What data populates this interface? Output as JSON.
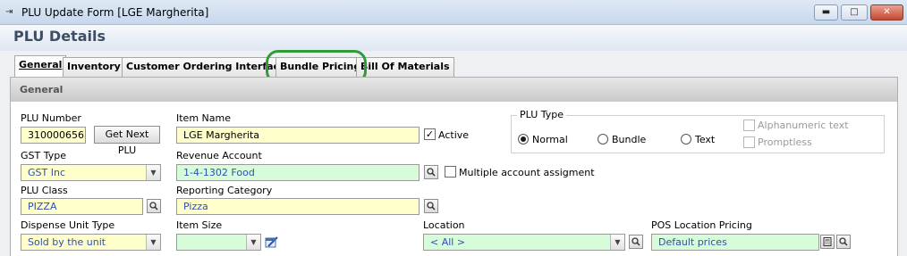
{
  "window": {
    "title": "PLU Update Form [LGE Margherita]",
    "min_label": "▬",
    "max_label": "□",
    "close_label": "✕"
  },
  "header": {
    "title": "PLU Details"
  },
  "tabs": [
    {
      "label": "General",
      "active": true
    },
    {
      "label": "Inventory"
    },
    {
      "label": "Customer Ordering Interface"
    },
    {
      "label": "Bundle Pricing",
      "highlighted": true
    },
    {
      "label": "Bill Of Materials"
    }
  ],
  "panel": {
    "title": "General"
  },
  "form": {
    "plu_number": {
      "label": "PLU Number",
      "value": "310000656",
      "button": "Get Next PLU"
    },
    "item_name": {
      "label": "Item Name",
      "value": "LGE Margherita"
    },
    "active": {
      "label": "Active",
      "checked": true
    },
    "gst_type": {
      "label": "GST Type",
      "value": "GST Inc"
    },
    "revenue_account": {
      "label": "Revenue Account",
      "value": "1-4-1302  Food"
    },
    "multiple_account": {
      "label": "Multiple account assigment",
      "checked": false
    },
    "plu_class": {
      "label": "PLU Class",
      "value": "PIZZA"
    },
    "reporting_category": {
      "label": "Reporting Category",
      "value": "Pizza"
    },
    "dispense_unit_type": {
      "label": "Dispense Unit Type",
      "value": "Sold by the unit"
    },
    "item_size": {
      "label": "Item Size",
      "value": ""
    },
    "location": {
      "label": "Location",
      "value": "< All >"
    },
    "pos_location_pricing": {
      "label": "POS Location Pricing",
      "value": "Default prices"
    },
    "plu_type": {
      "label": "PLU Type",
      "options": [
        "Normal",
        "Bundle",
        "Text"
      ],
      "selected": "Normal",
      "alphanumeric_text": "Alphanumeric text",
      "promptless": "Promptless"
    }
  },
  "colors": {
    "highlight": "#2f9c37",
    "yellow_field": "#ffffcc",
    "green_field": "#d6fcd9",
    "header_text": "#3c4d66"
  }
}
